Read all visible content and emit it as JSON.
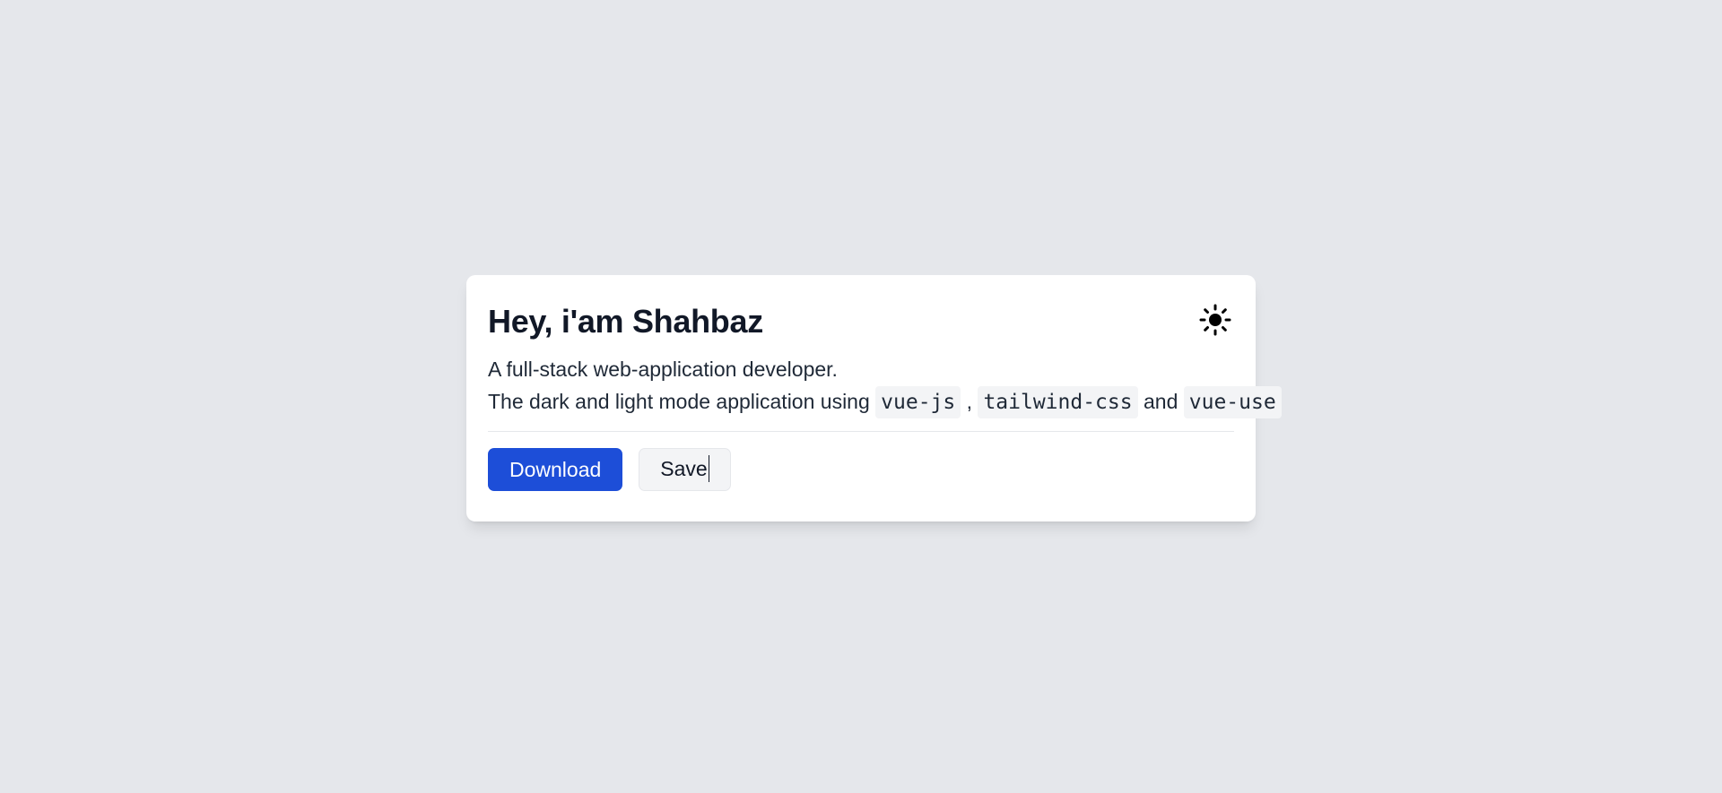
{
  "card": {
    "title": "Hey, i'am Shahbaz",
    "theme_icon": "sun-icon",
    "description": {
      "line1": "A full-stack web-application developer.",
      "line2_prefix": "The dark and light mode application using",
      "tech": [
        "vue-js",
        "tailwind-css",
        "vue-use"
      ],
      "separator_comma": ",",
      "separator_and": "and"
    },
    "actions": {
      "download_label": "Download",
      "save_label": "Save"
    }
  },
  "colors": {
    "page_background": "#e5e7eb",
    "card_background": "#ffffff",
    "primary_button": "#1d4ed8",
    "secondary_button": "#f3f4f6",
    "code_background": "#f3f4f6"
  }
}
